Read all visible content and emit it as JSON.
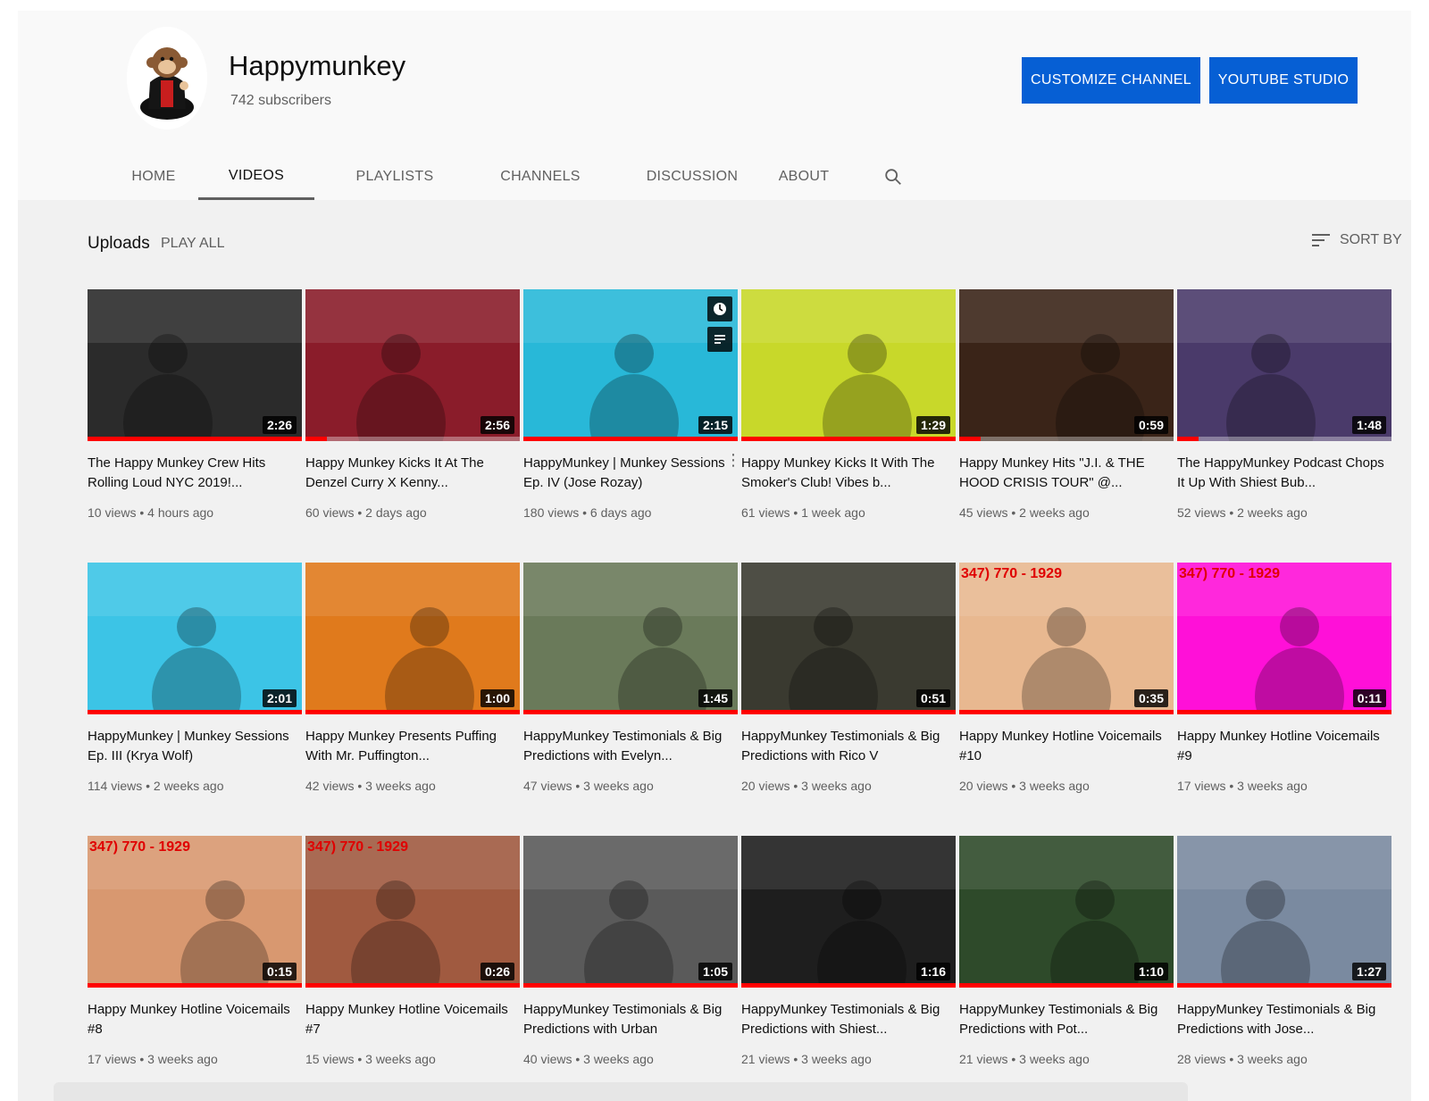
{
  "channel": {
    "name": "Happymunkey",
    "subscribers": "742 subscribers",
    "customize_label": "CUSTOMIZE CHANNEL",
    "studio_label": "YOUTUBE STUDIO",
    "accent_color": "#065fd4"
  },
  "tabs": [
    {
      "label": "HOME"
    },
    {
      "label": "VIDEOS",
      "active": true
    },
    {
      "label": "PLAYLISTS"
    },
    {
      "label": "CHANNELS"
    },
    {
      "label": "DISCUSSION"
    },
    {
      "label": "ABOUT"
    }
  ],
  "uploads": {
    "title": "Uploads",
    "play_all": "PLAY ALL",
    "sort_by": "SORT BY"
  },
  "videos": [
    {
      "title": "The Happy Munkey Crew Hits Rolling Loud NYC 2019!...",
      "meta": "10 views • 4 hours ago",
      "duration": "2:26",
      "progress": 1.0,
      "thumb_bg": "#2b2b2b"
    },
    {
      "title": "Happy Munkey Kicks It At The Denzel Curry X Kenny...",
      "meta": "60 views • 2 days ago",
      "duration": "2:56",
      "progress": 0.1,
      "thumb_bg": "#8a1c2a"
    },
    {
      "title": "HappyMunkey | Munkey Sessions Ep. IV (Jose Rozay)",
      "meta": "180 views • 6 days ago",
      "duration": "2:15",
      "progress": 1.0,
      "thumb_bg": "#28b8d8"
    },
    {
      "title": "Happy Munkey Kicks It With The Smoker's Club! Vibes b...",
      "meta": "61 views • 1 week ago",
      "duration": "1:29",
      "progress": 1.0,
      "thumb_bg": "#c8d82a"
    },
    {
      "title": "Happy Munkey Hits \"J.I. & THE HOOD CRISIS TOUR\" @...",
      "meta": "45 views • 2 weeks ago",
      "duration": "0:59",
      "progress": 0.1,
      "thumb_bg": "#3a2418"
    },
    {
      "title": "The HappyMunkey Podcast Chops It Up With Shiest Bub...",
      "meta": "52 views • 2 weeks ago",
      "duration": "1:48",
      "progress": 0.1,
      "thumb_bg": "#4a3a6a"
    },
    {
      "title": "HappyMunkey | Munkey Sessions Ep. III (Krya Wolf)",
      "meta": "114 views • 2 weeks ago",
      "duration": "2:01",
      "progress": 1.0,
      "thumb_bg": "#3cc4e6"
    },
    {
      "title": "Happy Munkey Presents Puffing With Mr. Puffington...",
      "meta": "42 views • 3 weeks ago",
      "duration": "1:00",
      "progress": 1.0,
      "thumb_bg": "#e07a1c"
    },
    {
      "title": "HappyMunkey Testimonials & Big Predictions with Evelyn...",
      "meta": "47 views • 3 weeks ago",
      "duration": "1:45",
      "progress": 1.0,
      "thumb_bg": "#6a7a5a"
    },
    {
      "title": "HappyMunkey Testimonials & Big Predictions with Rico V",
      "meta": "20 views • 3 weeks ago",
      "duration": "0:51",
      "progress": 1.0,
      "thumb_bg": "#3a3a30"
    },
    {
      "title": "Happy Munkey Hotline Voicemails #10",
      "meta": "20 views • 3 weeks ago",
      "duration": "0:35",
      "progress": 1.0,
      "thumb_bg": "#e8b890",
      "overlay_text": "347) 770 - 1929"
    },
    {
      "title": "Happy Munkey Hotline Voicemails #9",
      "meta": "17 views • 3 weeks ago",
      "duration": "0:11",
      "progress": 1.0,
      "thumb_bg": "#ff10d8",
      "overlay_text": "347) 770 - 1929"
    },
    {
      "title": "Happy Munkey Hotline Voicemails #8",
      "meta": "17 views • 3 weeks ago",
      "duration": "0:15",
      "progress": 1.0,
      "thumb_bg": "#d89870",
      "overlay_text": "347) 770 - 1929"
    },
    {
      "title": "Happy Munkey Hotline Voicemails #7",
      "meta": "15 views • 3 weeks ago",
      "duration": "0:26",
      "progress": 1.0,
      "thumb_bg": "#a05a40",
      "overlay_text": "347) 770 - 1929"
    },
    {
      "title": "HappyMunkey Testimonials & Big Predictions with Urban",
      "meta": "40 views • 3 weeks ago",
      "duration": "1:05",
      "progress": 1.0,
      "thumb_bg": "#5a5a5a"
    },
    {
      "title": "HappyMunkey Testimonials & Big Predictions with Shiest...",
      "meta": "21 views • 3 weeks ago",
      "duration": "1:16",
      "progress": 1.0,
      "thumb_bg": "#1e1e1e"
    },
    {
      "title": "HappyMunkey Testimonials & Big Predictions with Pot...",
      "meta": "21 views • 3 weeks ago",
      "duration": "1:10",
      "progress": 1.0,
      "thumb_bg": "#2e4a2a"
    },
    {
      "title": "HappyMunkey Testimonials & Big Predictions with Jose...",
      "meta": "28 views • 3 weeks ago",
      "duration": "1:27",
      "progress": 1.0,
      "thumb_bg": "#7a8aa0"
    }
  ],
  "icons": {
    "search": "search-icon",
    "sort": "sort-icon",
    "watch_later": "clock-icon",
    "add_to_queue": "queue-icon",
    "more": "more-vert-icon"
  }
}
